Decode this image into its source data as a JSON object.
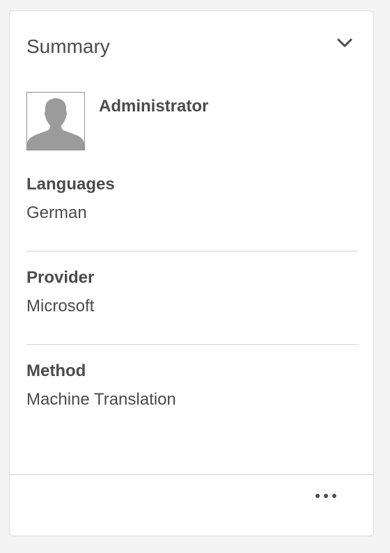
{
  "card": {
    "title": "Summary",
    "toggle_icon": "chevron-down-icon"
  },
  "user": {
    "name": "Administrator",
    "avatar_icon": "user-silhouette-icon"
  },
  "sections": [
    {
      "label": "Languages",
      "value": "German"
    },
    {
      "label": "Provider",
      "value": "Microsoft"
    },
    {
      "label": "Method",
      "value": "Machine Translation"
    }
  ],
  "footer": {
    "more_icon": "more-horizontal-icon"
  },
  "colors": {
    "text": "#4b4b4b",
    "divider": "#d3d3d3",
    "background": "#f4f4f4",
    "card": "#ffffff",
    "avatar_silhouette": "#9b9b9b"
  }
}
